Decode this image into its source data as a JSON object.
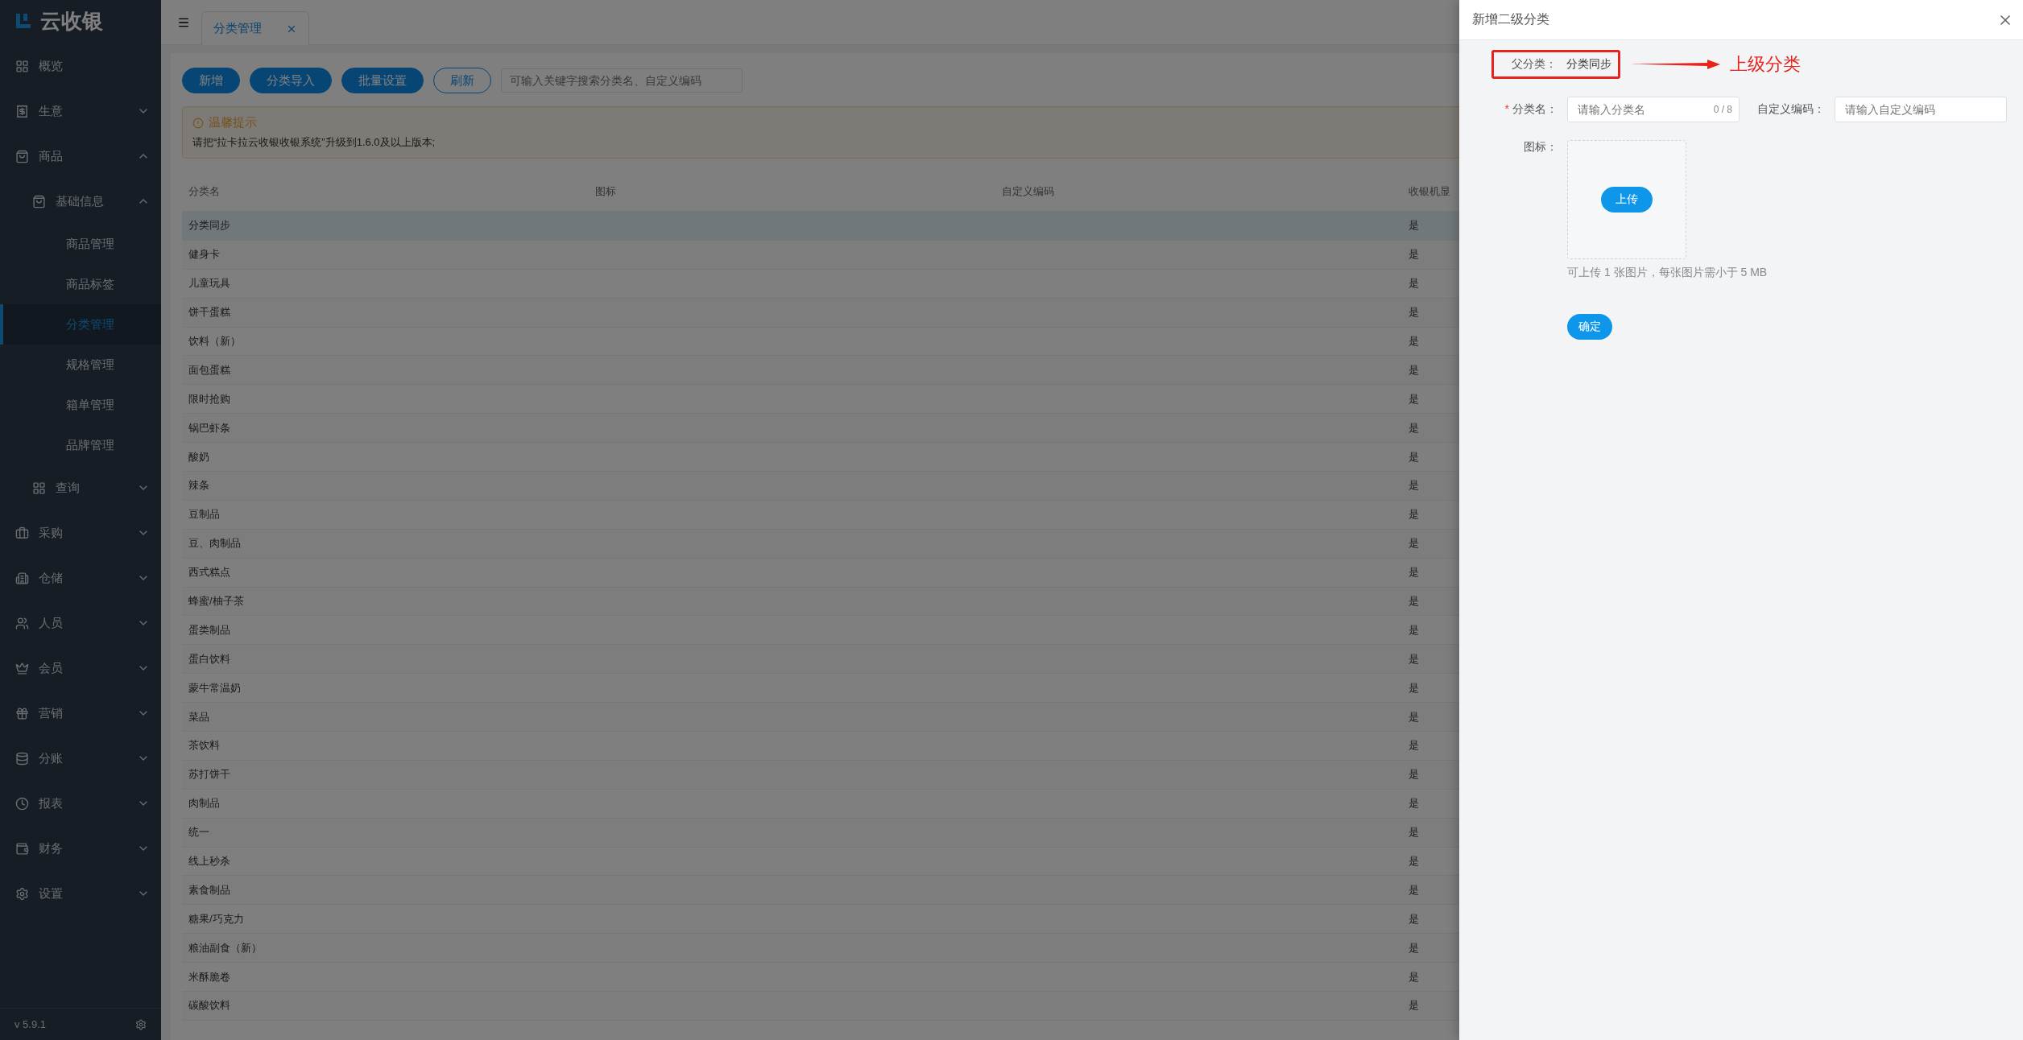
{
  "sidebar": {
    "logo": "云收银",
    "version": "v 5.9.1",
    "items": [
      {
        "label": "概览"
      },
      {
        "label": "生意",
        "expanded": false
      },
      {
        "label": "商品",
        "expanded": true,
        "children": [
          {
            "label": "基础信息",
            "expanded": true,
            "children": [
              {
                "label": "商品管理",
                "selected": false
              },
              {
                "label": "商品标签",
                "selected": false
              },
              {
                "label": "分类管理",
                "selected": true
              },
              {
                "label": "规格管理",
                "selected": false
              },
              {
                "label": "箱单管理",
                "selected": false
              },
              {
                "label": "品牌管理",
                "selected": false
              }
            ]
          },
          {
            "label": "查询",
            "expanded": false
          }
        ]
      },
      {
        "label": "采购",
        "expanded": false
      },
      {
        "label": "仓储",
        "expanded": false
      },
      {
        "label": "人员",
        "expanded": false
      },
      {
        "label": "会员",
        "expanded": false
      },
      {
        "label": "营销",
        "expanded": false
      },
      {
        "label": "分账",
        "expanded": false
      },
      {
        "label": "报表",
        "expanded": false
      },
      {
        "label": "财务",
        "expanded": false
      },
      {
        "label": "设置",
        "expanded": false
      }
    ]
  },
  "tabs": [
    {
      "label": "分类管理",
      "selected": true
    }
  ],
  "toolbar": {
    "buttons": [
      {
        "label": "新增",
        "kind": "primary"
      },
      {
        "label": "分类导入",
        "kind": "primary"
      },
      {
        "label": "批量设置",
        "kind": "primary"
      },
      {
        "label": "刷新",
        "kind": "outline"
      }
    ],
    "search": {
      "placeholder": "可输入关键字搜索分类名、自定义编码"
    }
  },
  "alert": {
    "title": "温馨提示",
    "message": "请把“拉卡拉云收银收银系统”升级到1.6.0及以上版本;"
  },
  "table": {
    "columns": [
      "分类名",
      "图标",
      "自定义编码",
      "收银机显"
    ],
    "rows": [
      {
        "name": "分类同步",
        "cashier_display": "是",
        "selected": true
      },
      {
        "name": "健身卡",
        "cashier_display": "是",
        "selected": false
      },
      {
        "name": "儿童玩具",
        "cashier_display": "是",
        "selected": false
      },
      {
        "name": "饼干蛋糕",
        "cashier_display": "是",
        "selected": false
      },
      {
        "name": "饮料（新）",
        "cashier_display": "是",
        "selected": false
      },
      {
        "name": "面包蛋糕",
        "cashier_display": "是",
        "selected": false
      },
      {
        "name": "限时抢购",
        "cashier_display": "是",
        "selected": false
      },
      {
        "name": "锅巴虾条",
        "cashier_display": "是",
        "selected": false
      },
      {
        "name": "酸奶",
        "cashier_display": "是",
        "selected": false
      },
      {
        "name": "辣条",
        "cashier_display": "是",
        "selected": false
      },
      {
        "name": "豆制品",
        "cashier_display": "是",
        "selected": false
      },
      {
        "name": "豆、肉制品",
        "cashier_display": "是",
        "selected": false
      },
      {
        "name": "西式糕点",
        "cashier_display": "是",
        "selected": false
      },
      {
        "name": "蜂蜜/柚子茶",
        "cashier_display": "是",
        "selected": false
      },
      {
        "name": "蛋类制品",
        "cashier_display": "是",
        "selected": false
      },
      {
        "name": "蛋白饮料",
        "cashier_display": "是",
        "selected": false
      },
      {
        "name": "蒙牛常温奶",
        "cashier_display": "是",
        "selected": false
      },
      {
        "name": "菜品",
        "cashier_display": "是",
        "selected": false
      },
      {
        "name": "茶饮料",
        "cashier_display": "是",
        "selected": false
      },
      {
        "name": "苏打饼干",
        "cashier_display": "是",
        "selected": false
      },
      {
        "name": "肉制品",
        "cashier_display": "是",
        "selected": false
      },
      {
        "name": "统一",
        "cashier_display": "是",
        "selected": false
      },
      {
        "name": "线上秒杀",
        "cashier_display": "是",
        "selected": false
      },
      {
        "name": "素食制品",
        "cashier_display": "是",
        "selected": false
      },
      {
        "name": "糖果/巧克力",
        "cashier_display": "是",
        "selected": false
      },
      {
        "name": "粮油副食（新）",
        "cashier_display": "是",
        "selected": false
      },
      {
        "name": "米酥脆卷",
        "cashier_display": "是",
        "selected": false
      },
      {
        "name": "碳酸饮料",
        "cashier_display": "是",
        "selected": false
      }
    ]
  },
  "drawer": {
    "title": "新增二级分类",
    "parent": {
      "label": "父分类：",
      "value": "分类同步",
      "annotation": "上级分类"
    },
    "name_field": {
      "label": "分类名：",
      "required_mark": "*",
      "placeholder": "请输入分类名",
      "counter": "0 / 8"
    },
    "code_field": {
      "label": "自定义编码：",
      "placeholder": "请输入自定义编码"
    },
    "icon_field": {
      "label": "图标：",
      "button": "上传",
      "hint": "可上传 1 张图片，每张图片需小于 5 MB"
    },
    "submit": "确定"
  }
}
